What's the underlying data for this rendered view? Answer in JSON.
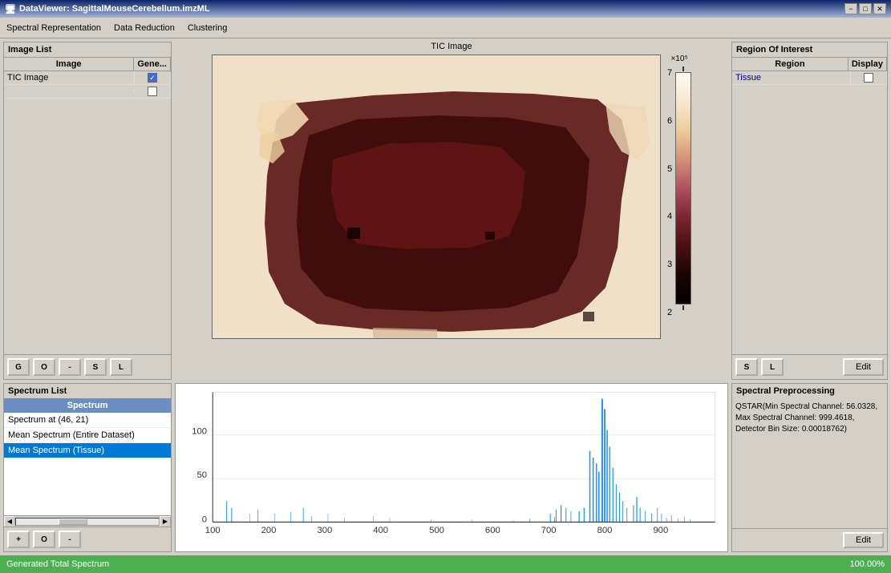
{
  "window": {
    "title": "DataViewer: SagittalMouseCerebellum.imzML",
    "min_btn": "−",
    "max_btn": "□",
    "close_btn": "✕"
  },
  "menu": {
    "items": [
      {
        "id": "spectral-representation",
        "label": "Spectral Representation"
      },
      {
        "id": "data-reduction",
        "label": "Data Reduction"
      },
      {
        "id": "clustering",
        "label": "Clustering"
      }
    ]
  },
  "image_list": {
    "title": "Image List",
    "columns": [
      "Image",
      "Gene..."
    ],
    "rows": [
      {
        "image": "TIC Image",
        "checked": true,
        "second_checked": false
      }
    ],
    "buttons": [
      "G",
      "O",
      "-",
      "S",
      "L"
    ]
  },
  "tic_image": {
    "title": "TIC Image",
    "colorbar_label": "×10⁵",
    "colorbar_ticks": [
      "7",
      "6",
      "5",
      "4",
      "3",
      "2"
    ]
  },
  "roi_panel": {
    "title": "Region Of Interest",
    "columns": [
      "Region",
      "Display"
    ],
    "rows": [
      {
        "region": "Tissue",
        "display": false
      }
    ],
    "buttons": [
      "S",
      "L"
    ],
    "edit_label": "Edit"
  },
  "spectrum_list": {
    "title": "Spectrum List",
    "header": "Spectrum",
    "items": [
      {
        "label": "Spectrum at (46, 21)",
        "selected": false
      },
      {
        "label": "Mean Spectrum (Entire Dataset)",
        "selected": false
      },
      {
        "label": "Mean Spectrum (Tissue)",
        "selected": true
      }
    ],
    "buttons": [
      "+",
      "O",
      "-"
    ]
  },
  "spectrum_chart": {
    "x_ticks": [
      "100",
      "200",
      "300",
      "400",
      "500",
      "600",
      "700",
      "800",
      "900"
    ],
    "y_ticks": [
      "0",
      "50",
      "100"
    ],
    "color": "#1e90ff"
  },
  "spectral_preprocessing": {
    "title": "Spectral Preprocessing",
    "content": "QSTAR(Min Spectral Channel: 56.0328, Max Spectral Channel: 999.4618, Detector Bin Size: 0.00018762)",
    "edit_label": "Edit"
  },
  "status_bar": {
    "text": "Generated Total Spectrum",
    "percent": "100.00%",
    "bg_color": "#4caf50"
  }
}
